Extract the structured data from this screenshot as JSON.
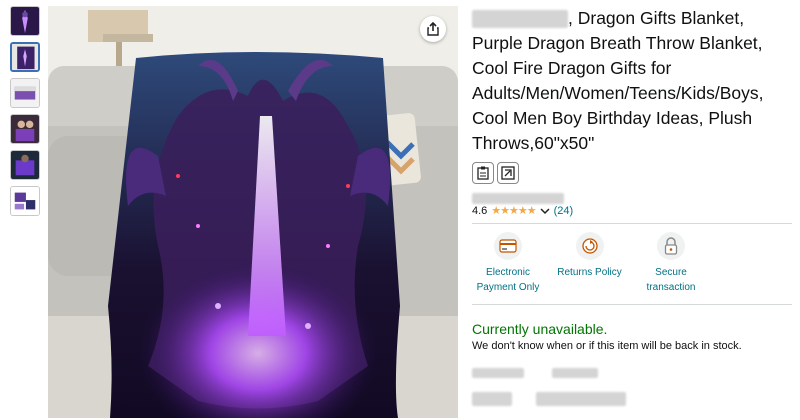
{
  "product": {
    "title_rest": ", Dragon Gifts Blanket, Purple Dragon Breath Throw Blanket, Cool Fire Dragon Gifts for Adults/Men/Women/Teens/Kids/Boys, Cool Men Boy Birthday Ideas, Plush Throws,60\"x50\"",
    "rating_value": "4.6",
    "rating_count": "(24)",
    "stars": "★★★★★"
  },
  "badges": [
    {
      "label": "Electronic Payment Only",
      "icon": "card-icon"
    },
    {
      "label": "Returns Policy",
      "icon": "return-icon"
    },
    {
      "label": "Secure transaction",
      "icon": "lock-icon"
    }
  ],
  "availability": {
    "status": "Currently unavailable.",
    "note": "We don't know when or if this item will be back in stock."
  },
  "colors": {
    "link": "#007185",
    "available_green": "#007600",
    "star": "#f3a847"
  }
}
